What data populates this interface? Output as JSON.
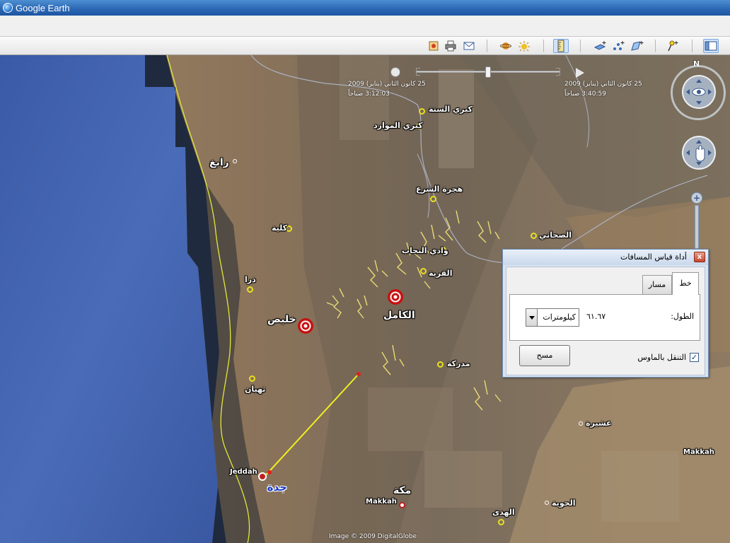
{
  "window": {
    "title": "Google Earth"
  },
  "toolbar": {
    "icons": [
      "sidebar-toggle-icon",
      "placemark-icon",
      "polygon-icon",
      "path-icon",
      "overlay-icon",
      "tour-icon",
      "sunlight-icon",
      "planets-icon",
      "email-icon",
      "print-icon",
      "save-image-icon",
      "ruler-icon"
    ]
  },
  "timeline": {
    "start_date": "25 كانون الثاني (يناير) 2009",
    "start_time": "3:12:03 صباحاً",
    "end_date": "25 كانون الثاني (يناير) 2009",
    "end_time": "3:40:59 صباحاً"
  },
  "nav": {
    "north_label": "N"
  },
  "places": {
    "rabigh": "رابغ",
    "kulayyah": "كلية",
    "dhuraa": "ذرا",
    "khulais": "خليص",
    "thuhban": "ثهبان",
    "jeddah_latin": "Jeddah",
    "jeddah_ar": "جدة",
    "makkah_latin": "Makkah",
    "makkah_ar": "مكة",
    "makkah_right": "Makkah",
    "kubri_sunnah": "كبري السنة",
    "kubri_mawarid": "كبري الموارد",
    "hijrat_shara": "هجرة الشرع",
    "wadi_nijab": "وادي النجاب",
    "qurayyah": "القرية",
    "kamil": "الكامل",
    "mudrikah": "مدركة",
    "sahaki": "الصحاني",
    "ushairah": "عشيرة",
    "huwiyah": "الحوية",
    "huda": "الهدى"
  },
  "copyright": "Image © 2009 DigitalGlobe",
  "ruler": {
    "title": "أداة قياس المسافات",
    "tab_line": "خط",
    "tab_path": "مسار",
    "length_label": "الطول:",
    "length_value": "٦١.٦٧",
    "unit": "كيلومترات",
    "mouse_nav_label": "التنقل بالماوس",
    "mouse_nav_checked": "✓",
    "clear_button": "مسح",
    "close": "x"
  }
}
